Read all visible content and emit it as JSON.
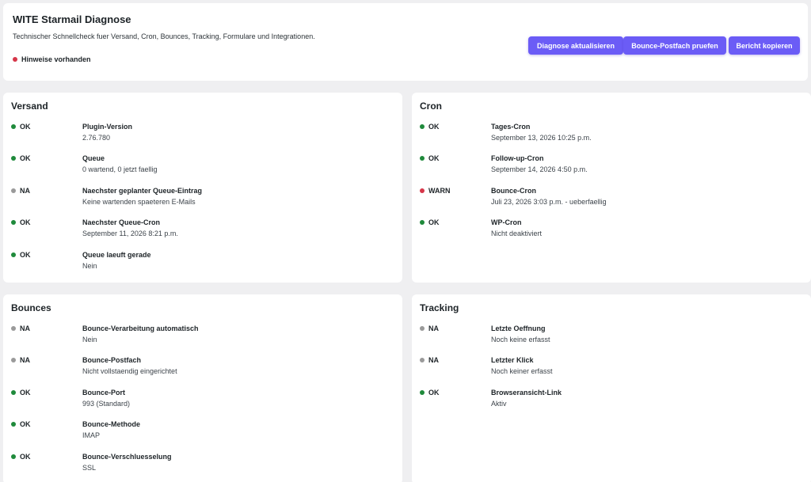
{
  "header": {
    "title": "WITE Starmail Diagnose",
    "subtitle": "Technischer Schnellcheck fuer Versand, Cron, Bounces, Tracking, Formulare und Integrationen.",
    "hint": "Hinweise vorhanden",
    "hint_color": "#d63649",
    "buttons": {
      "refresh": "Diagnose aktualisieren",
      "bounce": "Bounce-Postfach pruefen",
      "copy": "Bericht kopieren"
    }
  },
  "colors": {
    "ok": "#1f8a3b",
    "na": "#9a9a9a",
    "warn": "#d63649",
    "accent": "#6b5cf6"
  },
  "versand": {
    "title": "Versand",
    "rows": [
      {
        "status": "OK",
        "label": "Plugin-Version",
        "value": "2.76.780"
      },
      {
        "status": "OK",
        "label": "Queue",
        "value": "0 wartend, 0 jetzt faellig"
      },
      {
        "status": "NA",
        "label": "Naechster geplanter Queue-Eintrag",
        "value": "Keine wartenden spaeteren E-Mails"
      },
      {
        "status": "OK",
        "label": "Naechster Queue-Cron",
        "value": "September 11, 2026 8:21 p.m."
      },
      {
        "status": "OK",
        "label": "Queue laeuft gerade",
        "value": "Nein"
      }
    ]
  },
  "cron": {
    "title": "Cron",
    "rows": [
      {
        "status": "OK",
        "label": "Tages-Cron",
        "value": "September 13, 2026 10:25 p.m."
      },
      {
        "status": "OK",
        "label": "Follow-up-Cron",
        "value": "September 14, 2026 4:50 p.m."
      },
      {
        "status": "WARN",
        "label": "Bounce-Cron",
        "value": "Juli 23, 2026 3:03 p.m. - ueberfaellig"
      },
      {
        "status": "OK",
        "label": "WP-Cron",
        "value": "Nicht deaktiviert"
      }
    ]
  },
  "bounces": {
    "title": "Bounces",
    "rows": [
      {
        "status": "NA",
        "label": "Bounce-Verarbeitung automatisch",
        "value": "Nein"
      },
      {
        "status": "NA",
        "label": "Bounce-Postfach",
        "value": "Nicht vollstaendig eingerichtet"
      },
      {
        "status": "OK",
        "label": "Bounce-Port",
        "value": "993 (Standard)"
      },
      {
        "status": "OK",
        "label": "Bounce-Methode",
        "value": "IMAP"
      },
      {
        "status": "OK",
        "label": "Bounce-Verschluesselung",
        "value": "SSL"
      }
    ]
  },
  "tracking": {
    "title": "Tracking",
    "rows": [
      {
        "status": "NA",
        "label": "Letzte Oeffnung",
        "value": "Noch keine erfasst"
      },
      {
        "status": "NA",
        "label": "Letzter Klick",
        "value": "Noch keiner erfasst"
      },
      {
        "status": "OK",
        "label": "Browseransicht-Link",
        "value": "Aktiv"
      }
    ]
  }
}
